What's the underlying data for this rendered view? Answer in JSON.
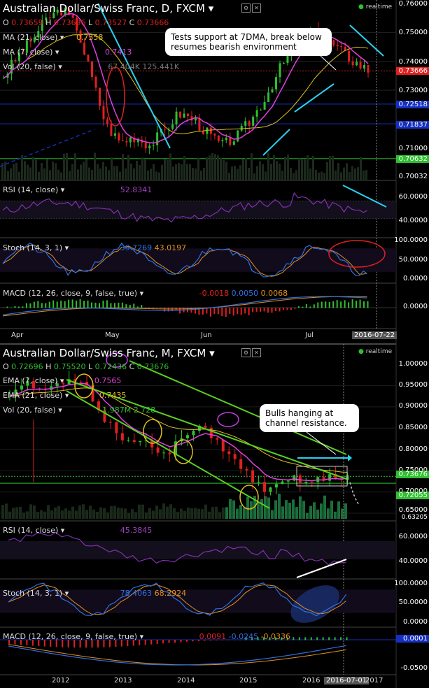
{
  "top": {
    "title": "Australian Dollar/Swiss Franc, D, FXCM",
    "ohlc": {
      "o_lbl": "O",
      "o": "0.73659",
      "h_lbl": "H",
      "h": "0.73696",
      "l_lbl": "L",
      "l": "0.73527",
      "c_lbl": "C",
      "c": "0.73666"
    },
    "ma21": {
      "label": "MA (21, close)",
      "value": "0.7358"
    },
    "ma7": {
      "label": "MA (7, close)",
      "value": "0.7413"
    },
    "vol": {
      "label": "Vol (20, false)",
      "v1": "67.404K",
      "v2": "125.441K"
    },
    "realtime": "realtime",
    "annotation": "Tests support at 7DMA, break below resumes bearish environment",
    "price_labels": [
      "0.76000",
      "0.75000",
      "0.74000",
      "0.73000",
      "0.71000",
      "0.70032"
    ],
    "price_tags": {
      "current": "0.73666",
      "blue1": "0.72518",
      "blue2": "0.71837",
      "green": "0.70632"
    },
    "rsi": {
      "label": "RSI (14, close)",
      "value": "52.8341",
      "levels": [
        "60.0000",
        "40.0000"
      ]
    },
    "stoch": {
      "label": "Stoch (14, 3, 1)",
      "k": "39.7269",
      "d": "43.0197",
      "levels": [
        "100.0000",
        "50.0000",
        "0.0000"
      ]
    },
    "macd": {
      "label": "MACD (12, 26, close, 9, false, true)",
      "v1": "-0.0018",
      "v2": "0.0050",
      "v3": "0.0068",
      "level": "0.0000"
    },
    "x_labels": [
      "Apr",
      "May",
      "Jun",
      "Jul"
    ],
    "x_highlight": "2016-07-22",
    "colors": {
      "up": "#2fbf2f",
      "down": "#e02020",
      "ma7": "#e040e0",
      "ma21": "#e0c020",
      "annot": "#2ad0f0"
    }
  },
  "bottom": {
    "title": "Australian Dollar/Swiss Franc, M, FXCM",
    "ohlc": {
      "o_lbl": "O",
      "o": "0.72696",
      "h_lbl": "H",
      "h": "0.75520",
      "l_lbl": "L",
      "l": "0.72436",
      "c_lbl": "C",
      "c": "0.73676"
    },
    "ema7": {
      "label": "EMA (7, close)",
      "value": "0.7565"
    },
    "ema21": {
      "label": "EMA (21, close)",
      "value": "0.7435"
    },
    "vol": {
      "label": "Vol (20, false)",
      "v1": "1.987M",
      "v2": "2.728"
    },
    "realtime": "realtime",
    "annotation": "Bulls hanging at channel resistance.",
    "price_labels": [
      "1.00000",
      "0.95000",
      "0.90000",
      "0.85000",
      "0.80000",
      "0.75000",
      "0.70000",
      "0.65000",
      "0.63205"
    ],
    "price_tags": {
      "current": "0.73676",
      "green": "0.72055"
    },
    "rsi": {
      "label": "RSI (14, close)",
      "value": "45.3845",
      "levels": [
        "60.0000",
        "40.0000"
      ]
    },
    "stoch": {
      "label": "Stoch (14, 3, 1)",
      "k": "78.4063",
      "d": "68.2924",
      "levels": [
        "100.0000",
        "50.0000",
        "0.0000"
      ]
    },
    "macd": {
      "label": "MACD (12, 26, close, 9, false, true)",
      "v1": "0.0091",
      "v2": "-0.0245",
      "v3": "-0.0336",
      "tag": "0.0001",
      "level": "-0.0500"
    },
    "x_labels": [
      "2012",
      "2013",
      "2014",
      "2015",
      "2016",
      "2017"
    ],
    "x_highlight": "2016-07-01"
  },
  "chart_data": [
    {
      "type": "candlestick",
      "title": "Australian Dollar/Swiss Franc, D, FXCM",
      "x": [
        "Apr",
        "May",
        "Jun",
        "Jul"
      ],
      "ylim": [
        0.7,
        0.76
      ],
      "series": [
        {
          "name": "Price (close, approx.)",
          "values": [
            0.735,
            0.742,
            0.748,
            0.755,
            0.758,
            0.752,
            0.735,
            0.718,
            0.712,
            0.714,
            0.711,
            0.716,
            0.722,
            0.72,
            0.715,
            0.711,
            0.714,
            0.72,
            0.728,
            0.738,
            0.745,
            0.75,
            0.748,
            0.744,
            0.74,
            0.737
          ]
        },
        {
          "name": "MA (7, close)",
          "last": 0.7413
        },
        {
          "name": "MA (21, close)",
          "last": 0.7358
        },
        {
          "name": "RSI (14, close)",
          "last": 52.8341
        },
        {
          "name": "Stoch (14, 3, 1)",
          "k": 39.7269,
          "d": 43.0197
        },
        {
          "name": "MACD (12, 26, close, 9, false, true)",
          "values": [
            -0.0018,
            0.005,
            0.0068
          ]
        }
      ]
    },
    {
      "type": "candlestick",
      "title": "Australian Dollar/Swiss Franc, M, FXCM",
      "x": [
        "2012",
        "2013",
        "2014",
        "2015",
        "2016",
        "2017"
      ],
      "ylim": [
        0.632,
        1.0
      ],
      "series": [
        {
          "name": "Price (close, approx.)",
          "values": [
            0.93,
            0.96,
            0.95,
            0.94,
            0.95,
            0.96,
            0.94,
            0.88,
            0.85,
            0.82,
            0.83,
            0.8,
            0.78,
            0.82,
            0.84,
            0.85,
            0.82,
            0.78,
            0.75,
            0.72,
            0.7,
            0.72,
            0.73,
            0.72,
            0.73,
            0.735,
            0.737
          ]
        },
        {
          "name": "EMA (7, close)",
          "last": 0.7565
        },
        {
          "name": "EMA (21, close)",
          "last": 0.7435
        },
        {
          "name": "RSI (14, close)",
          "last": 45.3845
        },
        {
          "name": "Stoch (14, 3, 1)",
          "k": 78.4063,
          "d": 68.2924
        },
        {
          "name": "MACD (12, 26, close, 9, false, true)",
          "values": [
            0.0091,
            -0.0245,
            -0.0336
          ]
        }
      ]
    }
  ]
}
